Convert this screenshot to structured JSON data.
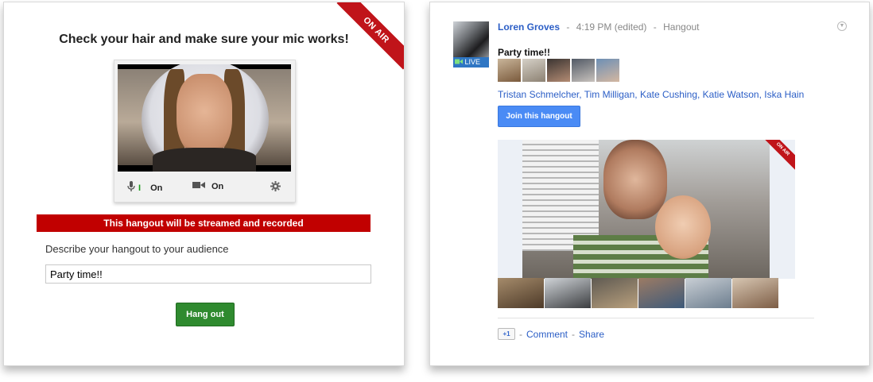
{
  "left": {
    "onair_label": "ON AIR",
    "heading": "Check your hair and make sure your mic works!",
    "mic_level": "I",
    "mic_state": "On",
    "camera_state": "On",
    "banner": "This hangout will be streamed and recorded",
    "describe_label": "Describe your hangout to your audience",
    "describe_value": "Party time!!",
    "hangout_button": "Hang out"
  },
  "right": {
    "live_badge": "LIVE",
    "author": "Loren Groves",
    "time": "4:19 PM (edited)",
    "post_type": "Hangout",
    "title": "Party time!!",
    "participants": "Tristan Schmelcher, Tim Milligan, Kate Cushing, Katie Watson, Iska Hain",
    "join_button": "Join this hangout",
    "video_onair_label": "ON AIR",
    "plus_one": "+1",
    "comment": "Comment",
    "share": "Share",
    "sep": "-"
  },
  "colors": {
    "onair_red": "#c0141a",
    "banner_red": "#c10000",
    "hangout_green": "#2f8a2f",
    "join_blue": "#4a8bf5",
    "link_blue": "#2b5ec6"
  }
}
